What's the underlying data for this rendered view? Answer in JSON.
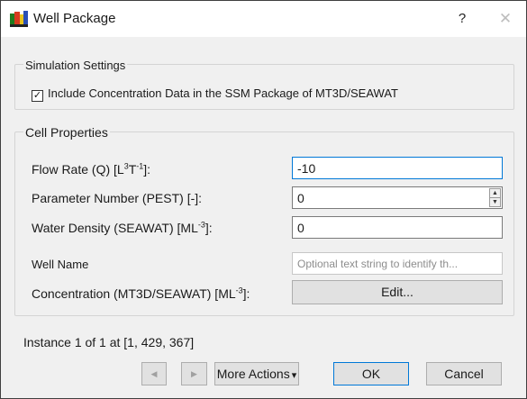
{
  "window": {
    "title": "Well Package",
    "help_label": "?",
    "close_label": "✕"
  },
  "simulation": {
    "group_title": "Simulation Settings",
    "checkbox_checked": true,
    "checkbox_label": "Include Concentration Data in the SSM Package of MT3D/SEAWAT"
  },
  "cell": {
    "group_title": "Cell Properties",
    "flow_rate": {
      "label_prefix": "Flow Rate (Q) [L",
      "exp1": "3",
      "mid": "T",
      "exp2": "-1",
      "suffix": "]:",
      "value": "-10"
    },
    "param_number": {
      "label": "Parameter Number (PEST) [-]:",
      "value": "0"
    },
    "water_density": {
      "label_prefix": "Water Density (SEAWAT) [ML",
      "exp": "-3",
      "suffix": "]:",
      "value": "0"
    },
    "well_name": {
      "label": "Well Name",
      "placeholder": "Optional text string to identify th..."
    },
    "concentration": {
      "label_prefix": "Concentration (MT3D/SEAWAT) [ML",
      "exp": "-3",
      "suffix": "]:",
      "button": "Edit..."
    }
  },
  "instance_text": "Instance 1 of 1 at [1, 429, 367]",
  "footer": {
    "prev_icon": "◀",
    "next_icon": "▶",
    "more_actions": "More Actions",
    "more_actions_arrow": "▾",
    "ok": "OK",
    "cancel": "Cancel"
  }
}
